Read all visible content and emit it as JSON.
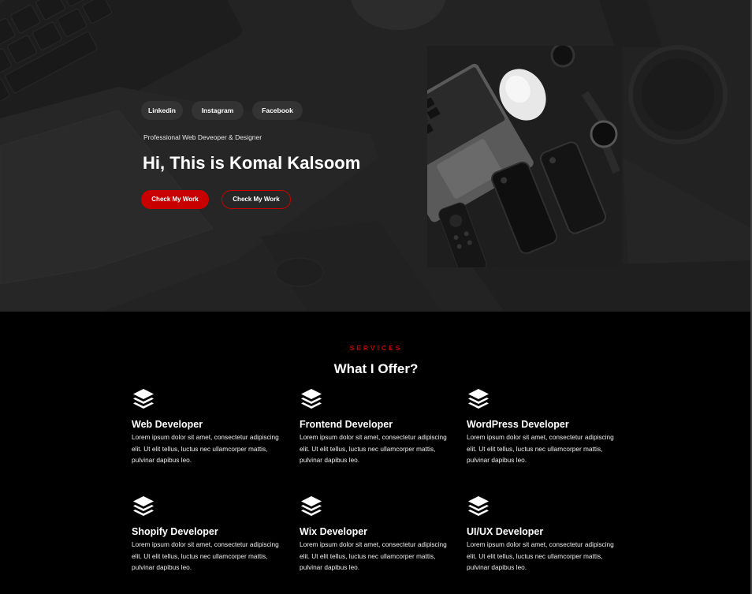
{
  "hero": {
    "social": [
      "Linkedin",
      "Instagram",
      "Facebook"
    ],
    "subtitle": "Professional Web Deveoper & Designer",
    "headline": "Hi, This is Komal Kalsoom",
    "primary_button": "Check My Work",
    "secondary_button": "Check My Work"
  },
  "services": {
    "eyebrow": "SERVICES",
    "title": "What I Offer?",
    "items": [
      {
        "title": "Web Developer",
        "icon": "layers-icon",
        "text": "Lorem ipsum dolor sit amet, consectetur adipiscing elit. Ut elit tellus, luctus nec ullamcorper mattis, pulvinar dapibus leo."
      },
      {
        "title": "Frontend Developer",
        "icon": "layers-icon",
        "text": "Lorem ipsum dolor sit amet, consectetur adipiscing elit. Ut elit tellus, luctus nec ullamcorper mattis, pulvinar dapibus leo."
      },
      {
        "title": "WordPress Developer",
        "icon": "layers-icon",
        "text": "Lorem ipsum dolor sit amet, consectetur adipiscing elit. Ut elit tellus, luctus nec ullamcorper mattis, pulvinar dapibus leo."
      },
      {
        "title": "Shopify Developer",
        "icon": "layers-icon",
        "text": "Lorem ipsum dolor sit amet, consectetur adipiscing elit. Ut elit tellus, luctus nec ullamcorper mattis, pulvinar dapibus leo."
      },
      {
        "title": "Wix Developer",
        "icon": "layers-icon",
        "text": "Lorem ipsum dolor sit amet, consectetur adipiscing elit. Ut elit tellus, luctus nec ullamcorper mattis, pulvinar dapibus leo."
      },
      {
        "title": "UI/UX Developer",
        "icon": "layers-icon",
        "text": "Lorem ipsum dolor sit amet, consectetur adipiscing elit. Ut elit tellus, luctus nec ullamcorper mattis, pulvinar dapibus leo."
      }
    ]
  },
  "colors": {
    "accent": "#c90000",
    "hero_bg": "#2a2a2a",
    "section_bg": "#000000",
    "pill_bg": "#333333"
  }
}
